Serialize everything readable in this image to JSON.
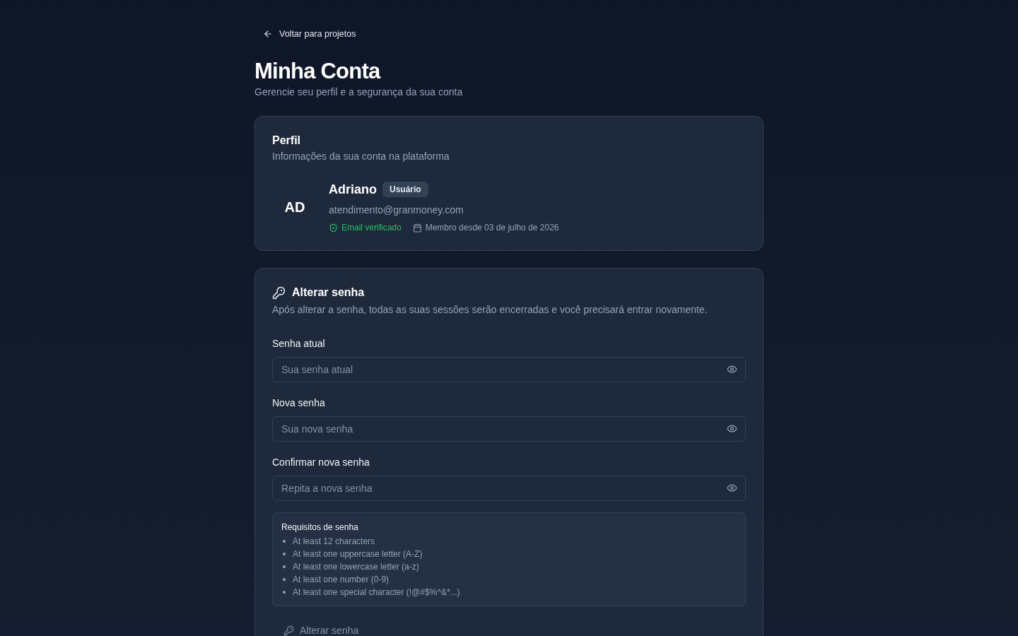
{
  "back_link": {
    "label": "Voltar para projetos"
  },
  "header": {
    "title": "Minha Conta",
    "subtitle": "Gerencie seu perfil e a segurança da sua conta"
  },
  "profile_card": {
    "title": "Perfil",
    "description": "Informações da sua conta na plataforma",
    "avatar_initials": "AD",
    "name": "Adriano",
    "role_badge": "Usuário",
    "email": "atendimento@granmoney.com",
    "email_status": {
      "label": "Email verificado",
      "verified": true
    },
    "member_since": "Membro desde 03 de julho de 2026"
  },
  "password_card": {
    "title": "Alterar senha",
    "description": "Após alterar a senha, todas as suas sessões serão encerradas e você precisará entrar novamente.",
    "fields": [
      {
        "label": "Senha atual",
        "placeholder": "Sua senha atual"
      },
      {
        "label": "Nova senha",
        "placeholder": "Sua nova senha"
      },
      {
        "label": "Confirmar nova senha",
        "placeholder": "Repita a nova senha"
      }
    ],
    "requirements": {
      "title": "Requisitos de senha",
      "items": [
        "At least 12 characters",
        "At least one uppercase letter (A-Z)",
        "At least one lowercase letter (a-z)",
        "At least one number (0-9)",
        "At least one special character (!@#$%^&*...)"
      ]
    },
    "submit_button": {
      "label": "Alterar senha",
      "disabled": true
    }
  }
}
